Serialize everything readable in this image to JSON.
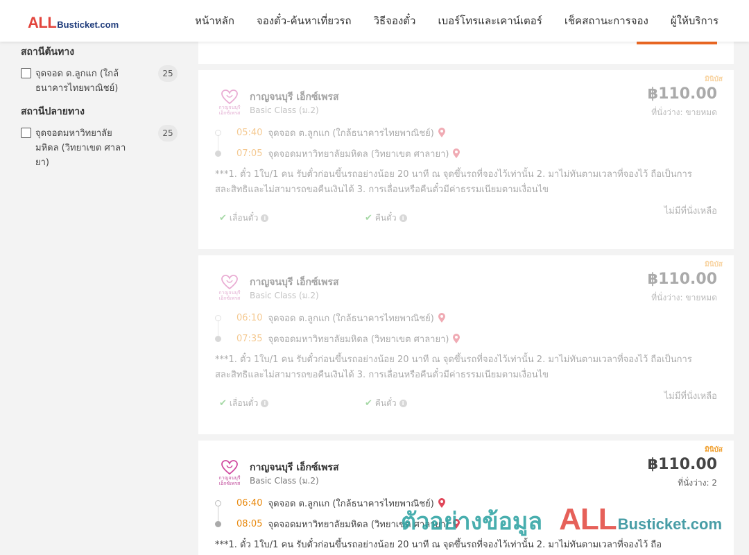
{
  "header": {
    "logo_all": "ALL",
    "logo_rest": "Busticket.com",
    "nav": [
      "หน้าหลัก",
      "จองตั๋ว-ค้นหาเที่ยวรถ",
      "วิธีจองตั๋ว",
      "เบอร์โทรและเคาน์เตอร์",
      "เช็คสถานะการจอง",
      "ผู้ให้บริการ"
    ]
  },
  "sidebar": {
    "origin": {
      "title": "สถานีต้นทาง",
      "options": [
        {
          "label": "จุดจอด ต.ลูกแก (ใกล้ธนาคารไทยพาณิชย์)",
          "count": "25"
        }
      ]
    },
    "destination": {
      "title": "สถานีปลายทาง",
      "options": [
        {
          "label": "จุดจอดมหาวิทยาลัยมหิดล (วิทยาเขต ศาลายา)",
          "count": "25"
        }
      ]
    }
  },
  "trips": [
    {
      "badge": "มินิบัส",
      "operator": "กาญจนบุรี เอ็กซ์เพรส",
      "logo_text": "กาญจนบุรี เอ็กซ์เพรส",
      "bus_class": "Basic Class (ม.2)",
      "price": "฿110.00",
      "seats": "ที่นั่งว่าง: ขายหมด",
      "depart_time": "05:40",
      "depart_stop": "จุดจอด ต.ลูกแก (ใกล้ธนาคารไทยพาณิชย์)",
      "arrive_time": "07:05",
      "arrive_stop": "จุดจอดมหาวิทยาลัยมหิดล (วิทยาเขต ศาลายา)",
      "policy": "***1. ตั๋ว 1ใบ/1 คน รับตั๋วก่อนขึ้นรถอย่างน้อย 20 นาที ณ จุดขึ้นรถที่จองไว้เท่านั้น 2. มาไม่ทันตามเวลาที่จองไว้ ถือเป็นการสละสิทธิและไม่สามารถขอคืนเงินได้ 3. การเลื่อนหรือคืนตั๋วมีค่าธรรมเนียมตามเงื่อนไข",
      "feature_reschedule": "เลื่อนตั๋ว",
      "feature_refund": "คืนตั๋ว",
      "availability": "ไม่มีที่นั่งเหลือ"
    },
    {
      "badge": "มินิบัส",
      "operator": "กาญจนบุรี เอ็กซ์เพรส",
      "logo_text": "กาญจนบุรี เอ็กซ์เพรส",
      "bus_class": "Basic Class (ม.2)",
      "price": "฿110.00",
      "seats": "ที่นั่งว่าง: ขายหมด",
      "depart_time": "06:10",
      "depart_stop": "จุดจอด ต.ลูกแก (ใกล้ธนาคารไทยพาณิชย์)",
      "arrive_time": "07:35",
      "arrive_stop": "จุดจอดมหาวิทยาลัยมหิดล (วิทยาเขต ศาลายา)",
      "policy": "***1. ตั๋ว 1ใบ/1 คน รับตั๋วก่อนขึ้นรถอย่างน้อย 20 นาที ณ จุดขึ้นรถที่จองไว้เท่านั้น 2. มาไม่ทันตามเวลาที่จองไว้ ถือเป็นการสละสิทธิและไม่สามารถขอคืนเงินได้ 3. การเลื่อนหรือคืนตั๋วมีค่าธรรมเนียมตามเงื่อนไข",
      "feature_reschedule": "เลื่อนตั๋ว",
      "feature_refund": "คืนตั๋ว",
      "availability": "ไม่มีที่นั่งเหลือ"
    },
    {
      "badge": "มินิบัส",
      "operator": "กาญจนบุรี เอ็กซ์เพรส",
      "logo_text": "กาญจนบุรี เอ็กซ์เพรส",
      "bus_class": "Basic Class (ม.2)",
      "price": "฿110.00",
      "seats": "ที่นั่งว่าง: 2",
      "depart_time": "06:40",
      "depart_stop": "จุดจอด ต.ลูกแก (ใกล้ธนาคารไทยพาณิชย์)",
      "arrive_time": "08:05",
      "arrive_stop": "จุดจอดมหาวิทยาลัยมหิดล (วิทยาเขต ศาลายา)",
      "policy": "***1. ตั๋ว 1ใบ/1 คน รับตั๋วก่อนขึ้นรถอย่างน้อย 20 นาที ณ จุดขึ้นรถที่จองไว้เท่านั้น 2. มาไม่ทันตามเวลาที่จองไว้ ถือ"
    }
  ],
  "watermark": {
    "thai": "ตัวอย่างข้อมูล",
    "all": "ALL",
    "rest": "Busticket.com"
  },
  "icons": {
    "pin": "location-pin-icon",
    "check": "check-icon",
    "info": "info-icon",
    "checkbox": "checkbox-icon"
  },
  "colors": {
    "accent": "#f06a24",
    "time": "#e8870a",
    "pin": "#e0475a",
    "check": "#3aaa3a",
    "badge": "#f0a030",
    "logo_red": "#e2443c",
    "logo_blue": "#1d3a7a"
  }
}
